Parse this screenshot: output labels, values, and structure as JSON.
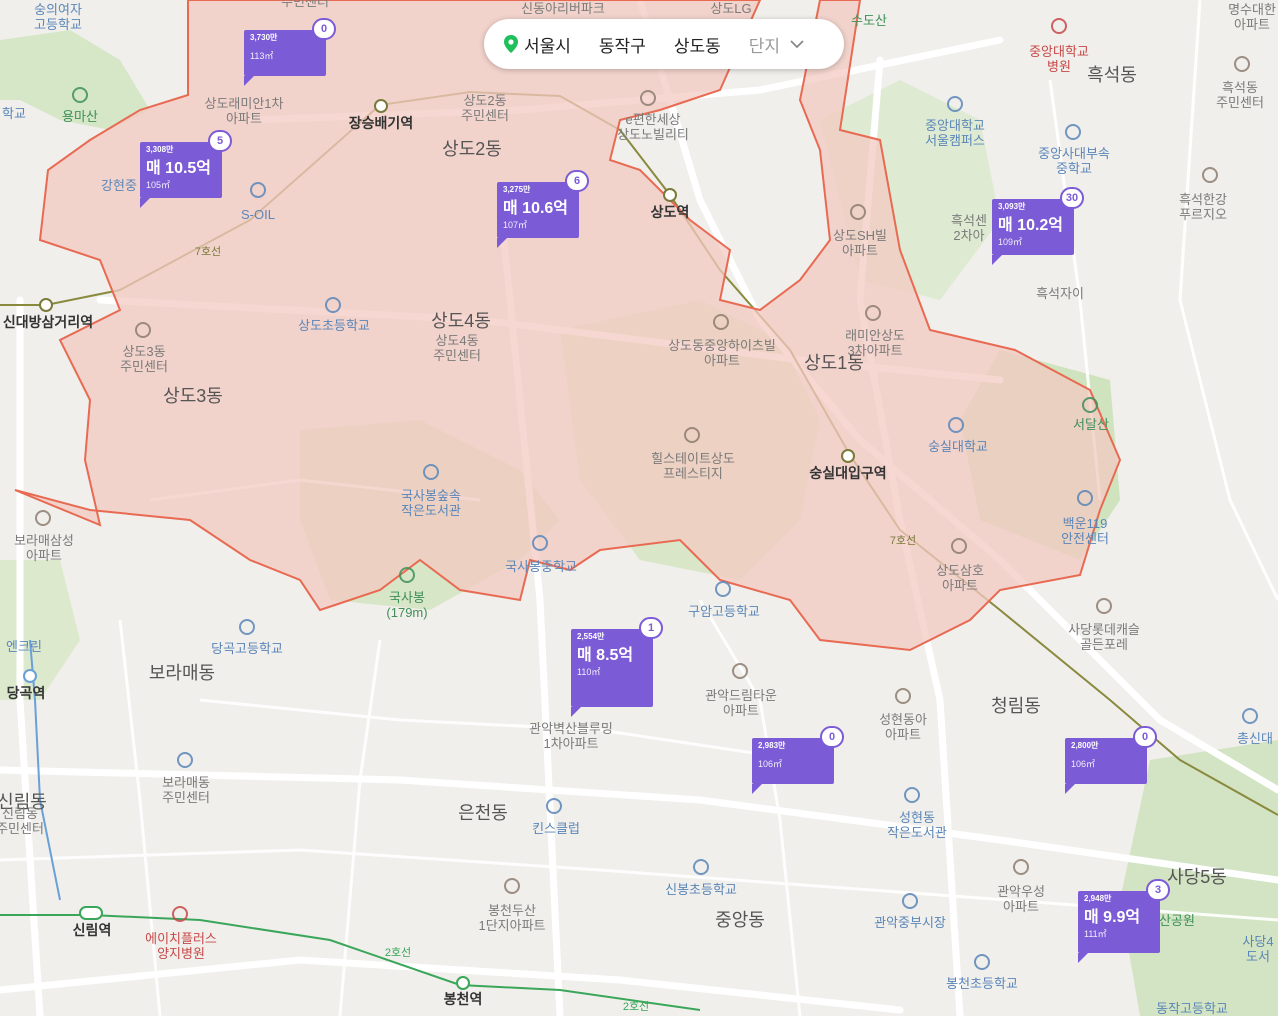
{
  "breadcrumb": {
    "city": "서울시",
    "district": "동작구",
    "dong": "상도동",
    "filter": "단지"
  },
  "icons": {
    "location": "location-pin-icon",
    "dropdown": "chevron-down-icon",
    "subway": "subway-station-icon",
    "school": "school-icon",
    "building": "building-icon",
    "mountain": "mountain-icon",
    "library": "library-icon",
    "hospital": "hospital-icon"
  },
  "colors": {
    "boundary_fill": "#f3c9c2",
    "boundary_stroke": "#e86a52",
    "pin": "#7b5bd6",
    "park": "#d6e7c8",
    "line2": "#3aa65a",
    "line7": "#8a8a3e"
  },
  "dong_labels": [
    "상도2동",
    "상도4동",
    "상도3동",
    "상도1동",
    "흑석동",
    "보라매동",
    "은천동",
    "중앙동",
    "청림동",
    "사당5동",
    "신림동",
    "상도2동"
  ],
  "stations": [
    "장승배기역",
    "상도역",
    "신대방삼거리역",
    "숭실대입구역",
    "당곡역",
    "신림역",
    "봉천역"
  ],
  "line_labels": [
    "7호선",
    "7호선",
    "2호선",
    "2호선"
  ],
  "pois": {
    "top_left_school": "숭의여자\n고등학교",
    "top_school": "주민센터",
    "school_edge": "학교",
    "mountain_yongma": "용마산",
    "apt_raemian1": "상도래미안1차\n아파트",
    "center_sangdo2": "상도2동\n주민센터",
    "e_pyeonhan": "e편한세상\n상도노빌리티",
    "apt_sinsangdo": "신동아리버파크",
    "apt_sangdolg": "상도LG",
    "gangnam_school": "강현중",
    "soil": "S-OIL",
    "sangdo_elem": "상도초등학교",
    "center_sangdo4": "상도4동\n주민센터",
    "center_sangdo3": "상도3동\n주민센터",
    "sangdo_sh": "상도SH빌\n아파트",
    "central_univ": "중앙대학교\n병원",
    "central_univ_campus": "중앙대학교\n서울캠퍼스",
    "central_mid": "중앙사대부속\n중학교",
    "heukseok_hangang": "흑석한강\n푸르지오",
    "heukseok_center": "흑석동\n주민센터",
    "heukseok_xi": "흑석자이",
    "heukseok_sen2": "흑석센\n2차아",
    "raemian3": "래미안상도\n3차아파트",
    "sangdo_jungang": "상도동중앙하이츠빌\n아파트",
    "soongsil": "숭실대학교",
    "seodalsan": "서달산",
    "hillstate": "힐스테이트상도\n프레스티지",
    "baekun119": "백운119\n안전센터",
    "sangdo_samho": "상도삼호\n아파트",
    "bora_samsung": "보라매삼성\n아파트",
    "guksabong_lib": "국사봉숲속\n작은도서관",
    "guksabong_mid": "국사봉중학교",
    "guksabong": "국사봉\n(179m)",
    "guam_high": "구암고등학교",
    "dangok_high": "당곡고등학교",
    "gwanak_baeksan": "관악벽산블루밍\n1차아파트",
    "gwanak_drimtown": "관악드림타운\n아파트",
    "seonghyeon_dongah": "성현동아\n아파트",
    "sadang_lotte": "사당롯데캐슬\n골든포레",
    "encrean": "엔크린",
    "bora_center": "보라매동\n주민센터",
    "kids_club": "킨스클럽",
    "seonghyeon_lib": "성현동\n작은도서관",
    "sinbong_elem": "신봉초등학교",
    "bongcheon_doosan": "봉천두산\n1단지아파트",
    "gwanak_woosung": "관악우성\n아파트",
    "gwanak_market": "관악중부시장",
    "hplus_hospital": "에이치플러스\n양지병원",
    "bongcheon_elem": "봉천초등학교",
    "sanggong": "산공원",
    "sadang_lib": "사당4\n도서",
    "chongshin": "총신대",
    "dongjak_high": "동작고등학교",
    "suncheon": "수도산",
    "sinlim_center": "신림동\n주민센터",
    "myeongsu_high": "명수대한\n아파트"
  },
  "listings": [
    {
      "ppm": "3,730만",
      "price": "",
      "area": "113㎡",
      "count": "0"
    },
    {
      "ppm": "3,308만",
      "price": "매 10.5억",
      "area": "105㎡",
      "count": "5"
    },
    {
      "ppm": "3,275만",
      "price": "매 10.6억",
      "area": "107㎡",
      "count": "6"
    },
    {
      "ppm": "3,093만",
      "price": "매 10.2억",
      "area": "109㎡",
      "count": "30"
    },
    {
      "ppm": "2,554만",
      "price": "매 8.5억",
      "area": "110㎡",
      "count": "1"
    },
    {
      "ppm": "2,983만",
      "price": "",
      "area": "106㎡",
      "count": "0"
    },
    {
      "ppm": "2,800만",
      "price": "",
      "area": "106㎡",
      "count": "0"
    },
    {
      "ppm": "2,948만",
      "price": "매 9.9억",
      "area": "111㎡",
      "count": "3"
    }
  ]
}
